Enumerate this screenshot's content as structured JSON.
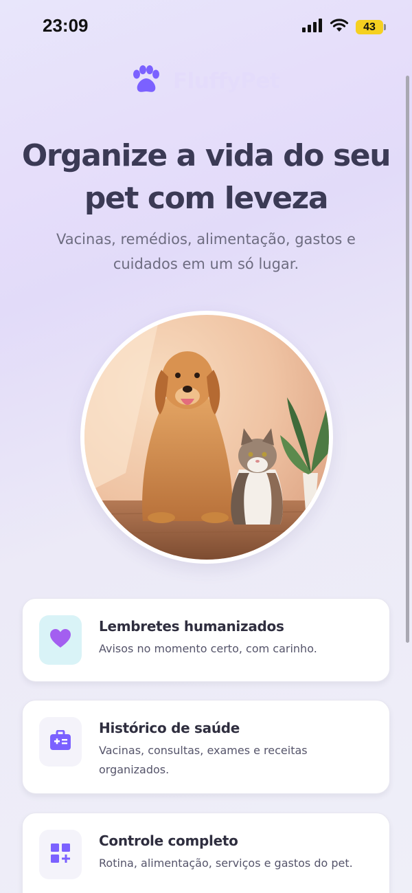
{
  "status_bar": {
    "time": "23:09",
    "battery": "43"
  },
  "app": {
    "name": "FluffyPet"
  },
  "hero": {
    "title_line1": "Organize a vida do seu",
    "title_line2": "pet com leveza",
    "subtitle": "Vacinas, remédios, alimentação, gastos e cuidados em um só lugar."
  },
  "features": [
    {
      "title": "Lembretes humanizados",
      "description": "Avisos no momento certo, com carinho.",
      "icon": "heart-icon"
    },
    {
      "title": "Histórico de saúde",
      "description": "Vacinas, consultas, exames e receitas organizados.",
      "icon": "medical-kit-icon"
    },
    {
      "title": "Controle completo",
      "description": "Rotina, alimentação, serviços e gastos do pet.",
      "icon": "grid-plus-icon"
    }
  ],
  "colors": {
    "accent": "#7b61ff",
    "heart": "#a35ff0",
    "heading": "#3b3a55",
    "battery": "#f5d020"
  }
}
